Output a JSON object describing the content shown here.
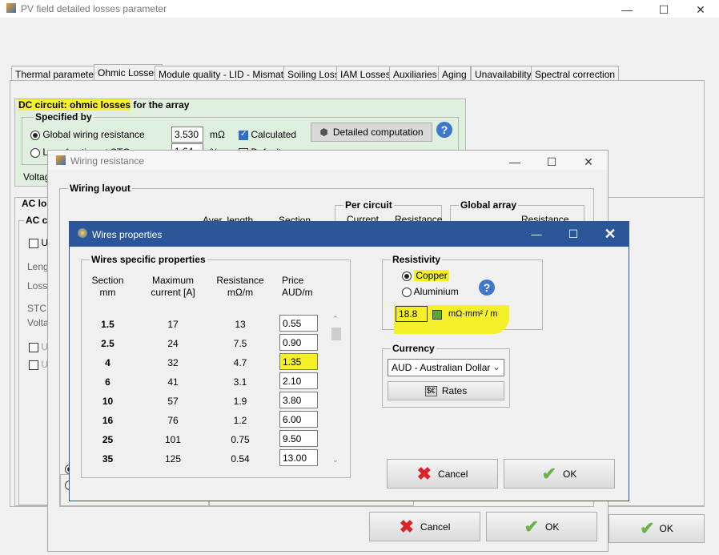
{
  "main_window": {
    "title": "PV field detailed losses parameter",
    "tabs": [
      "Thermal parameter",
      "Ohmic Losses",
      "Module quality - LID - Mismatch",
      "Soiling Loss",
      "IAM Losses",
      "Auxiliaries",
      "Aging",
      "Unavailability",
      "Spectral correction"
    ],
    "active_tab": "Ohmic Losses",
    "dc_group_title": "DC circuit: ohmic losses",
    "dc_group_title_suffix": "for the array",
    "specified_by": "Specified by",
    "global_wiring_label": "Global wiring resistance",
    "global_wiring_value": "3.530",
    "global_wiring_unit": "mΩ",
    "calculated_label": "Calculated",
    "loss_fraction_label": "Loss fraction at STC",
    "loss_fraction_value": "1.64",
    "loss_fraction_unit": "%",
    "default_label": "Default",
    "detailed_computation": "Detailed computation",
    "voltage_label": "Voltage",
    "ac_losses_title": "AC losses",
    "ac_circuit_title": "AC circuit",
    "left_labels": [
      "Us",
      "Lengt",
      "Loss f",
      "STC:",
      "Voltag",
      "Us",
      "Us"
    ],
    "ok_label": "OK"
  },
  "wiring_window": {
    "title": "Wiring resistance",
    "wiring_layout": "Wiring layout",
    "aver_length": "Aver. length",
    "section": "Section",
    "per_circuit": "Per circuit",
    "current": "Current",
    "resistance": "Resistance",
    "global_array": "Global array",
    "resistance2": "Resistance",
    "cancel_label": "Cancel",
    "ok_label": "OK"
  },
  "wires_dialog": {
    "title": "Wires properties",
    "group_title": "Wires specific properties",
    "headers": {
      "section": [
        "Section",
        "mm"
      ],
      "max_current": [
        "Maximum",
        "current [A]"
      ],
      "resistance": [
        "Resistance",
        "mΩ/m"
      ],
      "price": [
        "Price",
        "AUD/m"
      ]
    },
    "rows": [
      {
        "section": "1.5",
        "current": "17",
        "resistance": "13",
        "price": "0.55"
      },
      {
        "section": "2.5",
        "current": "24",
        "resistance": "7.5",
        "price": "0.90"
      },
      {
        "section": "4",
        "current": "32",
        "resistance": "4.7",
        "price": "1.35"
      },
      {
        "section": "6",
        "current": "41",
        "resistance": "3.1",
        "price": "2.10"
      },
      {
        "section": "10",
        "current": "57",
        "resistance": "1.9",
        "price": "3.80"
      },
      {
        "section": "16",
        "current": "76",
        "resistance": "1.2",
        "price": "6.00"
      },
      {
        "section": "25",
        "current": "101",
        "resistance": "0.75",
        "price": "9.50"
      },
      {
        "section": "35",
        "current": "125",
        "resistance": "0.54",
        "price": "13.00"
      }
    ],
    "resistivity_title": "Resistivity",
    "copper_label": "Copper",
    "aluminium_label": "Aluminium",
    "resistivity_value": "18.8",
    "resistivity_unit": "mΩ·mm² / m",
    "currency_title": "Currency",
    "currency_selected": "AUD - Australian Dollar",
    "rates_label": "Rates",
    "cancel_label": "Cancel",
    "ok_label": "OK"
  },
  "colors": {
    "highlight": "#f5f02a",
    "dialog_title_bar": "#2b579a",
    "cancel_x": "#d9252a",
    "ok_check": "#6bb24a"
  }
}
